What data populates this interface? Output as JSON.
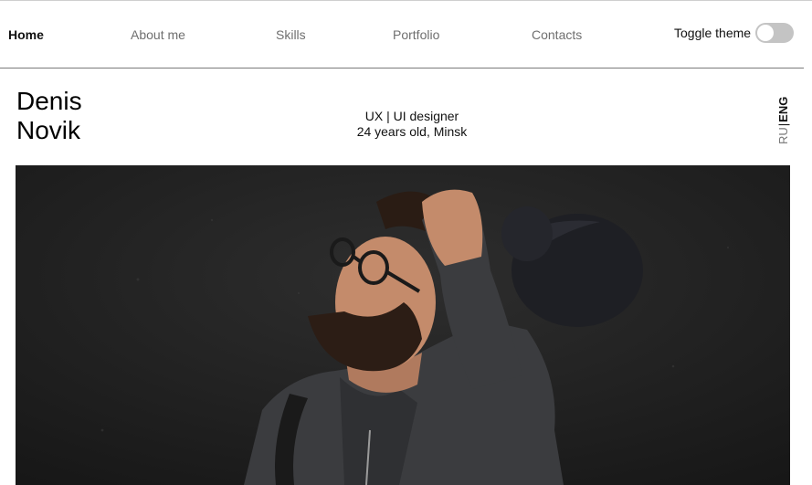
{
  "nav": {
    "items": [
      {
        "label": "Home",
        "active": true
      },
      {
        "label": "About me",
        "active": false
      },
      {
        "label": "Skills",
        "active": false
      },
      {
        "label": "Portfolio",
        "active": false
      },
      {
        "label": "Contacts",
        "active": false
      }
    ],
    "theme_toggle_label": "Toggle theme",
    "theme_toggle_on": false
  },
  "profile": {
    "first_name": "Denis",
    "last_name": "Novik",
    "role": "UX | UI designer",
    "info": "24 years old, Minsk"
  },
  "language": {
    "ru": "RU",
    "separator": "|",
    "eng": "ENG",
    "selected": "ENG"
  },
  "colors": {
    "text": "#111111",
    "nav_inactive": "#6f6f6f",
    "toggle_off": "#c4c4c4",
    "hero_background": "#222222"
  }
}
